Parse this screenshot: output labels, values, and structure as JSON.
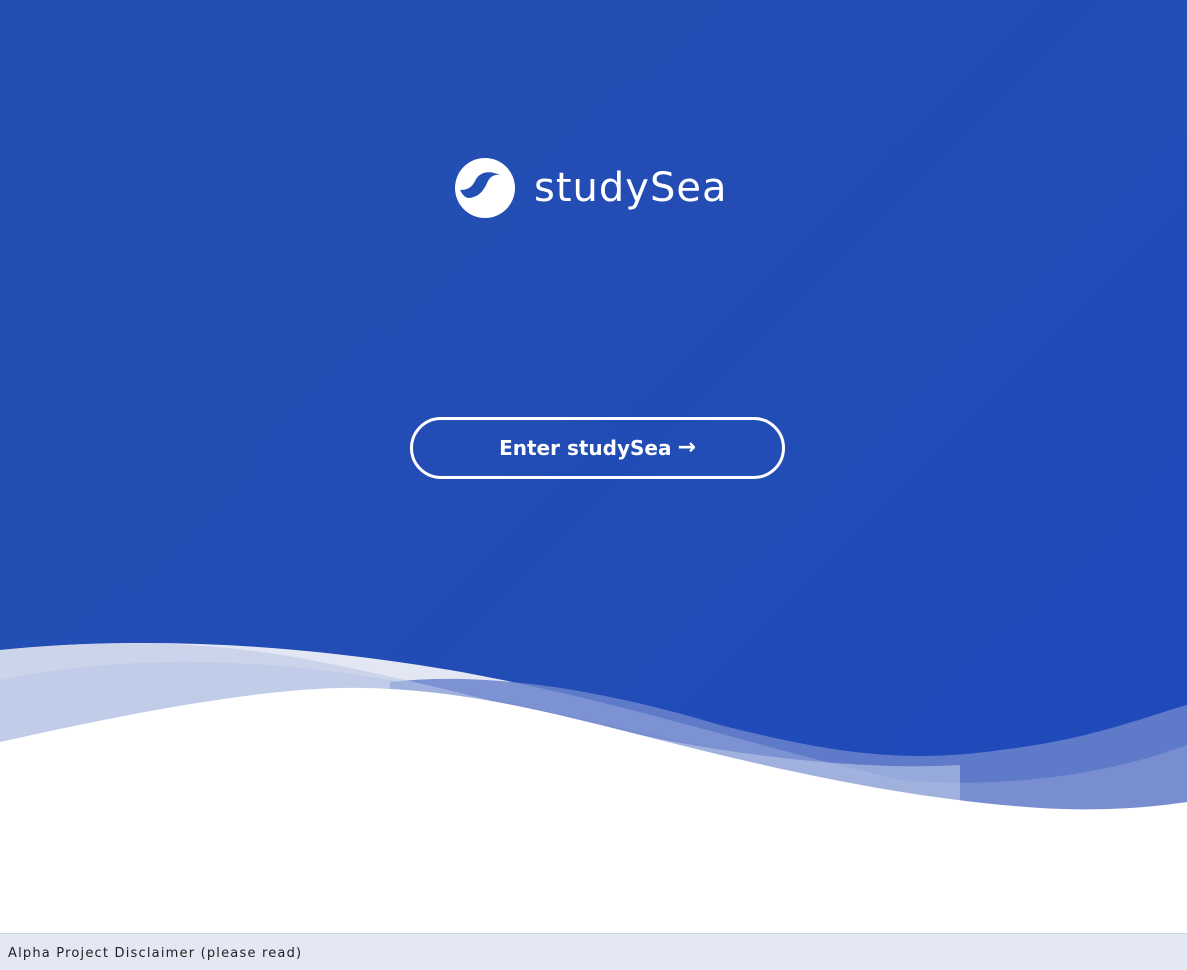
{
  "brand": {
    "name": "studySea",
    "logo_icon": "wave-circle-logo"
  },
  "hero": {
    "enter_button_label": "Enter studySea",
    "enter_button_icon": "arrow-right-icon",
    "arrow_glyph": "→"
  },
  "footer": {
    "disclaimer_label": "Alpha Project Disclaimer (please read)"
  },
  "colors": {
    "hero_blue": "#2350b3",
    "wave_light": "#e3e7f3",
    "wave_mid": "#bcc8e8",
    "wave_deep": "#6a83cb",
    "footer_bg": "#e4e8f4"
  }
}
